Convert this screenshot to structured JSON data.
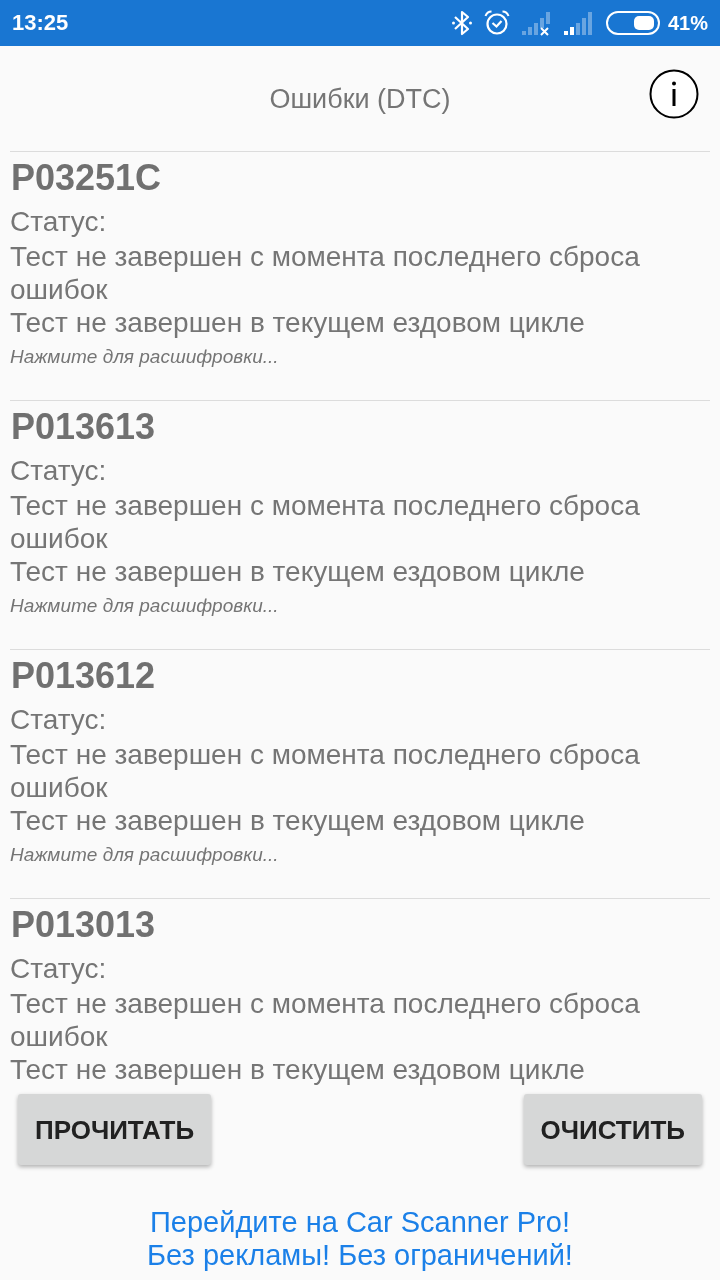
{
  "status_bar": {
    "time": "13:25",
    "battery": "41%"
  },
  "header": {
    "title": "Ошибки (DTC)"
  },
  "codes": [
    {
      "code": "P03251C",
      "status_label": "Статус:",
      "status_lines": [
        "Тест не завершен с момента последнего сброса ошибок",
        "Тест не завершен в текущем ездовом цикле"
      ],
      "hint": "Нажмите для расшифровки..."
    },
    {
      "code": "P013613",
      "status_label": "Статус:",
      "status_lines": [
        "Тест не завершен с момента последнего сброса ошибок",
        "Тест не завершен в текущем ездовом цикле"
      ],
      "hint": "Нажмите для расшифровки..."
    },
    {
      "code": "P013612",
      "status_label": "Статус:",
      "status_lines": [
        "Тест не завершен с момента последнего сброса ошибок",
        "Тест не завершен в текущем ездовом цикле"
      ],
      "hint": "Нажмите для расшифровки..."
    },
    {
      "code": "P013013",
      "status_label": "Статус:",
      "status_lines": [
        "Тест не завершен с момента последнего сброса ошибок",
        "Тест не завершен в текущем ездовом цикле"
      ]
    }
  ],
  "buttons": [
    {
      "label": "ПРОЧИТАТЬ"
    },
    {
      "label": "ОЧИСТИТЬ"
    }
  ],
  "promo": {
    "text": "Перейдите на Car Scanner Pro!\nБез рекламы! Без ограничений!"
  }
}
